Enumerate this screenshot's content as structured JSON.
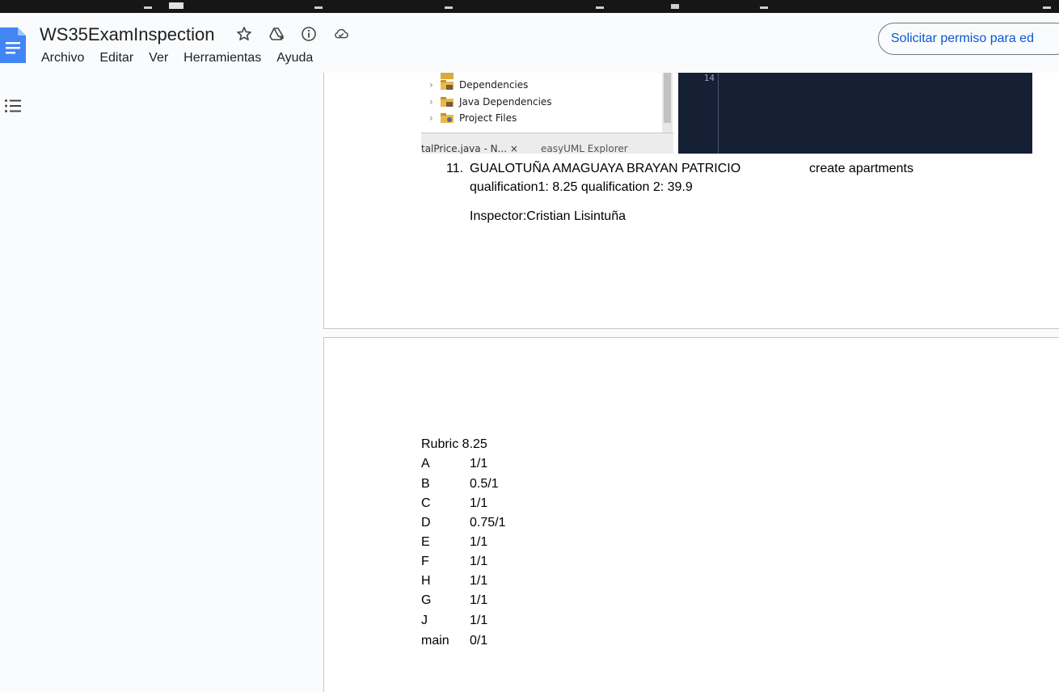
{
  "document": {
    "title": "WS35ExamInspection",
    "menu": [
      "Archivo",
      "Editar",
      "Ver",
      "Herramientas",
      "Ayuda"
    ],
    "share_button": "Solicitar permiso para ed"
  },
  "colors": {
    "accent": "#0b57d0",
    "docs_blue": "#4285f4",
    "ide_bg": "#152035"
  },
  "ide_snapshot": {
    "tree": [
      "Dependencies",
      "Java Dependencies",
      "Project Files"
    ],
    "tabs": [
      "talPrice.java - N...",
      "easyUML Explorer"
    ],
    "tab_close": "×",
    "line_number": "14"
  },
  "entry": {
    "number": "11.",
    "name": "GUALOTUÑA AMAGUAYA BRAYAN PATRICIO",
    "task": "create apartments",
    "qualifications": "qualification1: 8.25 qualification 2: 39.9",
    "inspector": "Inspector:Cristian Lisintuña"
  },
  "rubric": {
    "title": "Rubric 8.25",
    "items": [
      {
        "key": "A",
        "value": "1/1"
      },
      {
        "key": "B",
        "value": "0.5/1"
      },
      {
        "key": "C",
        "value": "1/1"
      },
      {
        "key": "D",
        "value": "0.75/1"
      },
      {
        "key": "E",
        "value": "1/1"
      },
      {
        "key": "F",
        "value": "1/1"
      },
      {
        "key": "H",
        "value": "1/1"
      },
      {
        "key": "G",
        "value": "1/1"
      },
      {
        "key": "J",
        "value": "1/1"
      },
      {
        "key": "main",
        "value": "0/1"
      }
    ]
  }
}
